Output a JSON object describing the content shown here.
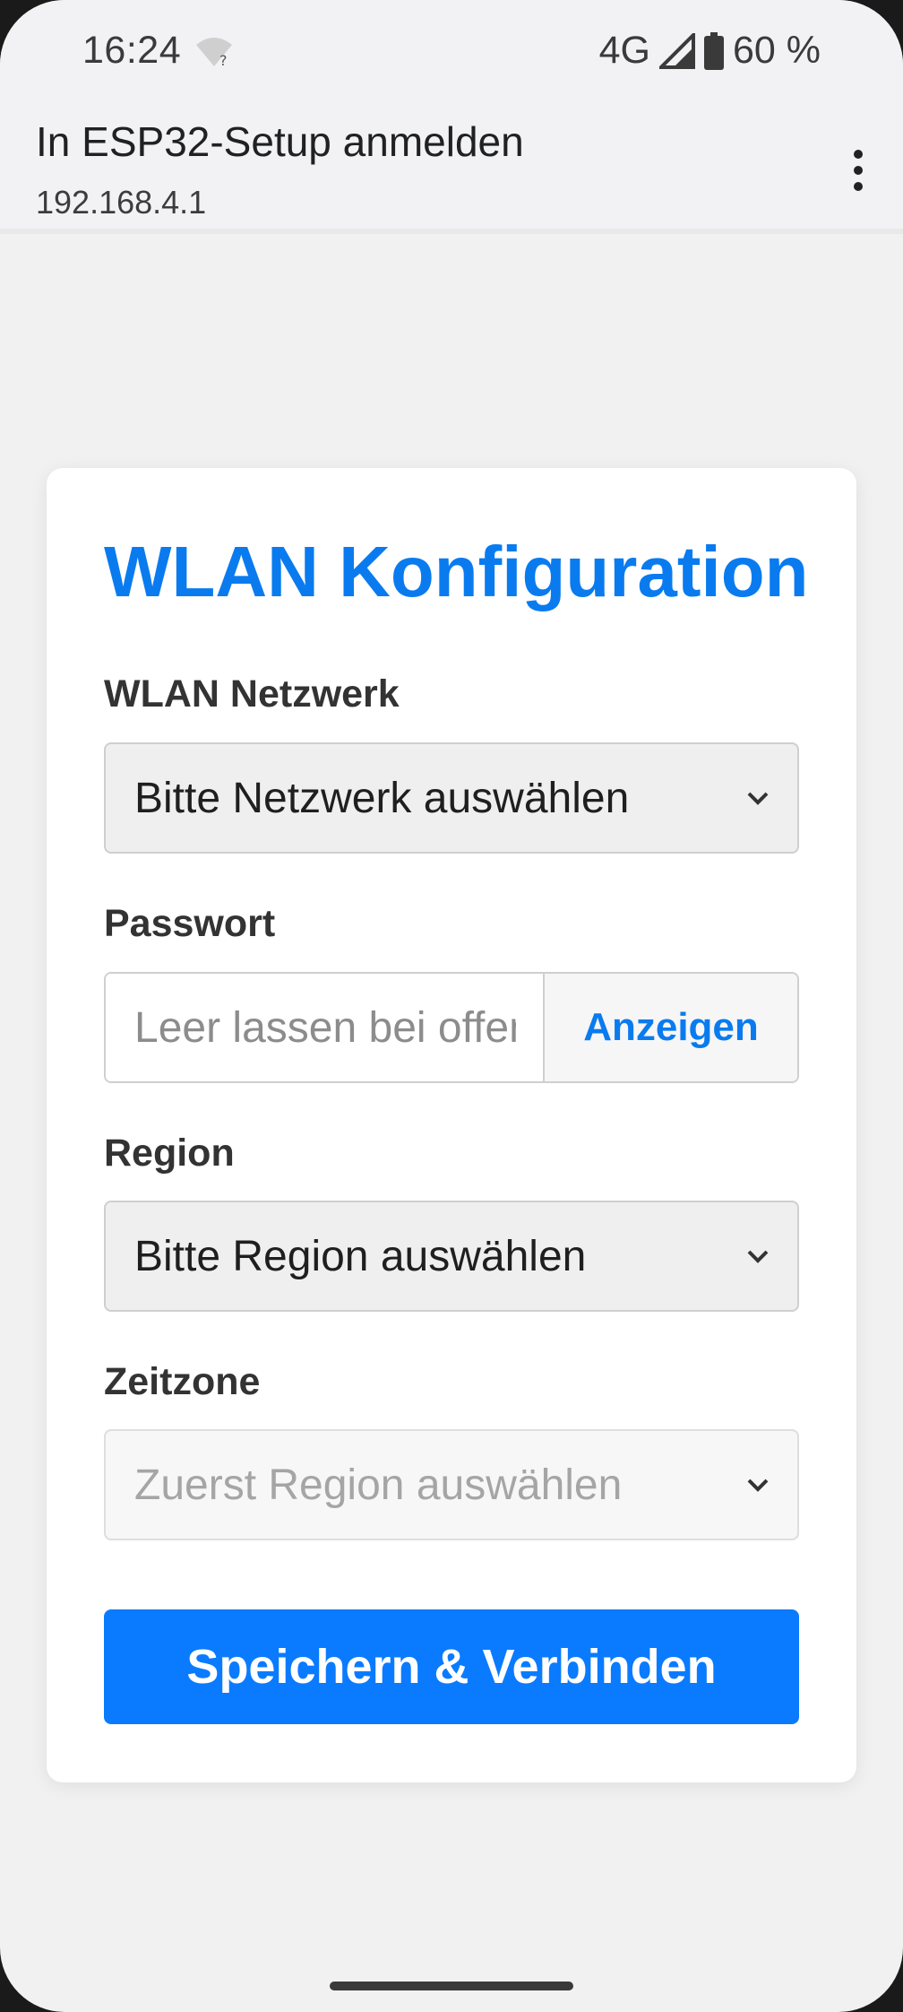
{
  "status_bar": {
    "time": "16:24",
    "network": "4G",
    "battery": "60 %",
    "icons": [
      "wifi-question-icon",
      "signal-icon",
      "battery-icon"
    ]
  },
  "header": {
    "title": "In ESP32-Setup anmelden",
    "subtitle": "192.168.4.1",
    "menu_icon": "more-vert-icon"
  },
  "form": {
    "title": "WLAN Konfiguration",
    "network_label": "WLAN Netzwerk",
    "network_selected": "Bitte Netzwerk auswählen",
    "password_label": "Passwort",
    "password_placeholder": "Leer lassen bei offenem Netzwerk",
    "password_show": "Anzeigen",
    "region_label": "Region",
    "region_selected": "Bitte Region auswählen",
    "timezone_label": "Zeitzone",
    "timezone_selected": "Zuerst Region auswählen",
    "submit": "Speichern & Verbinden"
  },
  "colors": {
    "accent": "#0a7bff",
    "title": "#0a7bef",
    "background": "#f1f1f1"
  }
}
